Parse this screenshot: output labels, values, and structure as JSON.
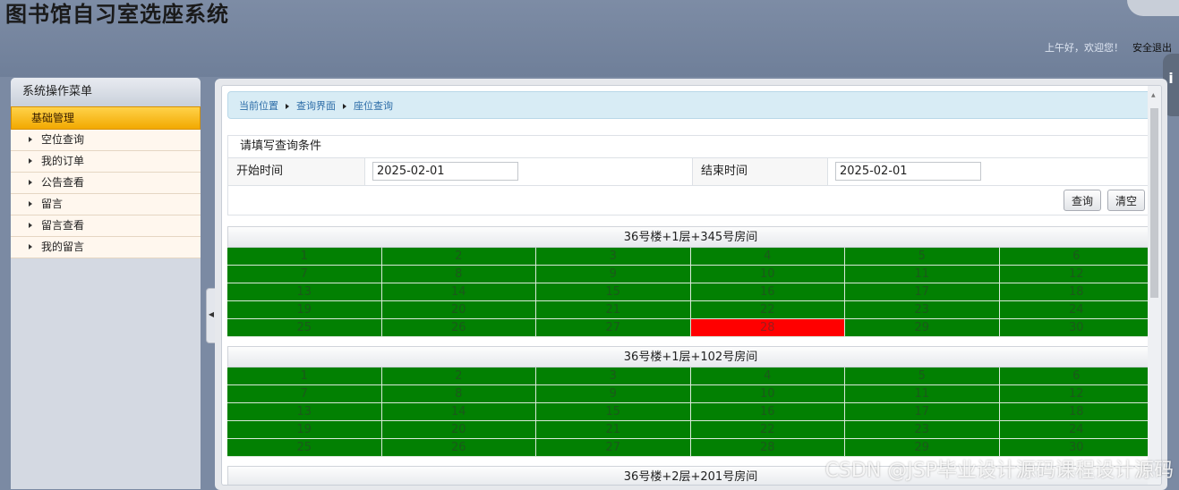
{
  "app_title": "图书馆自习室选座系统",
  "header": {
    "greeting": "上午好，欢迎您！",
    "logout": "安全退出"
  },
  "sidebar": {
    "title": "系统操作菜单",
    "group": "基础管理",
    "items": [
      {
        "label": "空位查询"
      },
      {
        "label": "我的订单"
      },
      {
        "label": "公告查看"
      },
      {
        "label": "留言"
      },
      {
        "label": "留言查看"
      },
      {
        "label": "我的留言"
      }
    ]
  },
  "breadcrumb": [
    "当前位置",
    "查询界面",
    "座位查询"
  ],
  "query": {
    "heading": "请填写查询条件",
    "start_label": "开始时间",
    "start_value": "2025-02-01",
    "end_label": "结束时间",
    "end_value": "2025-02-01",
    "query_button": "查询",
    "clear_button": "清空"
  },
  "rooms": [
    {
      "title": "36号楼+1层+345号房间",
      "seats": [
        "1",
        "2",
        "3",
        "4",
        "5",
        "6",
        "7",
        "8",
        "9",
        "10",
        "11",
        "12",
        "13",
        "14",
        "15",
        "16",
        "17",
        "18",
        "19",
        "20",
        "21",
        "22",
        "23",
        "24",
        "25",
        "26",
        "27",
        "28",
        "29",
        "30"
      ],
      "occupied": [
        "28"
      ]
    },
    {
      "title": "36号楼+1层+102号房间",
      "seats": [
        "1",
        "2",
        "3",
        "4",
        "5",
        "6",
        "7",
        "8",
        "9",
        "10",
        "11",
        "12",
        "13",
        "14",
        "15",
        "16",
        "17",
        "18",
        "19",
        "20",
        "21",
        "22",
        "23",
        "24",
        "25",
        "26",
        "27",
        "28",
        "29",
        "30"
      ],
      "occupied": []
    },
    {
      "title": "36号楼+2层+201号房间",
      "seats": [],
      "occupied": []
    }
  ],
  "watermark": "CSDN @JSP毕业设计源码课程设计源码",
  "colors": {
    "available": "#028002",
    "occupied": "#ff0000",
    "sidebar_group": "#f2a900"
  }
}
